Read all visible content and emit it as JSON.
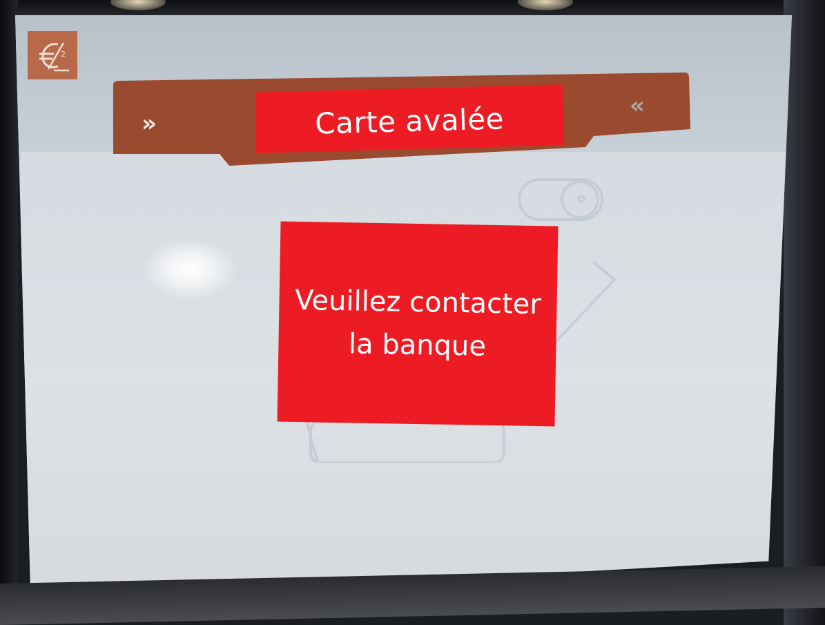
{
  "screen": {
    "title": "Carte avalée",
    "message_lines": [
      "Veuillez contacter",
      "la banque"
    ],
    "nav_left_glyph": "»",
    "nav_right_glyph": "«",
    "logo_icon": "euro-logo-icon"
  },
  "colors": {
    "banner_red": "#ed1c24",
    "header_brown": "#9a4a2e",
    "logo_orange": "#b8623e",
    "screen_background": "#d3d9df"
  }
}
